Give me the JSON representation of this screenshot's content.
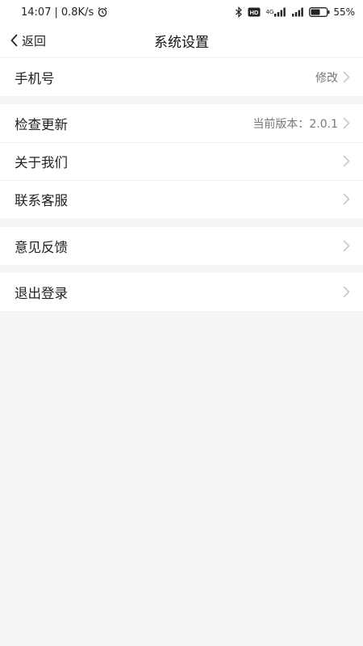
{
  "status_bar": {
    "time": "14:07",
    "separator": "|",
    "net_speed": "0.8K/s",
    "network_tag": "4G",
    "hd_tag": "HD",
    "battery": "55%"
  },
  "header": {
    "back_label": "返回",
    "title": "系统设置"
  },
  "groups": [
    {
      "rows": [
        {
          "label": "手机号",
          "value": "修改"
        }
      ]
    },
    {
      "rows": [
        {
          "label": "检查更新",
          "value": "当前版本：2.0.1"
        },
        {
          "label": "关于我们",
          "value": ""
        },
        {
          "label": "联系客服",
          "value": ""
        }
      ]
    },
    {
      "rows": [
        {
          "label": "意见反馈",
          "value": ""
        }
      ]
    },
    {
      "rows": [
        {
          "label": "退出登录",
          "value": ""
        }
      ]
    }
  ],
  "colors": {
    "background": "#f5f5f5",
    "surface": "#ffffff",
    "text": "#222222",
    "secondary_text": "#777777",
    "chevron": "#c8c8c8"
  }
}
